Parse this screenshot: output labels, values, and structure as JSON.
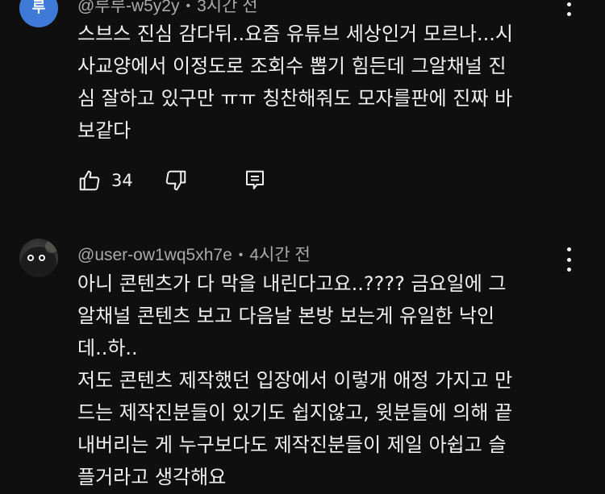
{
  "comments": [
    {
      "avatar_letter": "루",
      "username": "@루루-w5y2y",
      "time": "3시간 전",
      "text": "스브스 진심 감다뒤..요즘 유튜브 세상인거 모르나...시\n사교양에서 이정도로 조회수 뽑기 힘든데 그알채널 진\n심 잘하고 있구만 ㅠㅠ 칭찬해줘도 모자를판에 진짜 바\n보같다",
      "likes": "34"
    },
    {
      "username": "@user-ow1wq5xh7e",
      "time": "4시간 전",
      "text": "아니 콘텐츠가 다 막을 내린다고요..???? 금요일에 그\n알채널 콘텐츠 보고 다음날 본방 보는게 유일한 낙인\n데..하..\n저도 콘텐츠 제작했던 입장에서 이렇개 애정 가지고 만\n드는 제작진분들이 있기도 쉽지않고, 윗분들에 의해 끝\n내버리는 게 누구보다도 제작진분들이 제일 아쉽고 슬\n플거라고 생각해요"
    }
  ],
  "separator": "•",
  "icons": {
    "like": "thumb-up-icon",
    "dislike": "thumb-down-icon",
    "reply": "reply-icon",
    "more": "more-vert-icon"
  },
  "colors": {
    "background": "#0f0f0f",
    "text": "#f1f1f1",
    "meta": "#aaaaaa",
    "avatar": "#3f7ad8"
  }
}
